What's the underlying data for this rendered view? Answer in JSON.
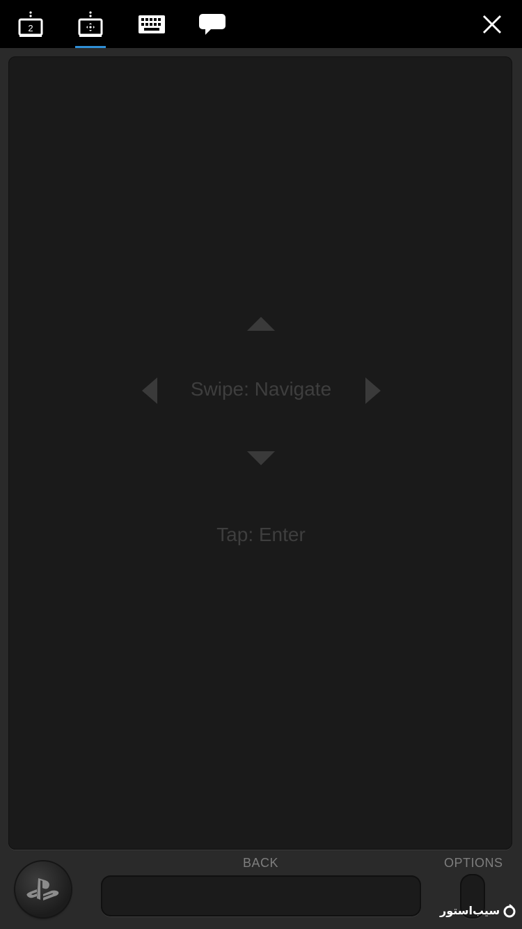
{
  "toolbar": {
    "tabs": [
      {
        "name": "second-screen-tab",
        "icon": "second-screen-icon",
        "badge": "2",
        "active": false
      },
      {
        "name": "remote-control-tab",
        "icon": "touchpad-icon",
        "active": true
      },
      {
        "name": "keyboard-tab",
        "icon": "keyboard-icon",
        "active": false
      },
      {
        "name": "comment-tab",
        "icon": "speech-bubble-icon",
        "active": false
      }
    ],
    "close_icon": "close-icon"
  },
  "touchpad": {
    "swipe_hint": "Swipe: Navigate",
    "tap_hint": "Tap: Enter",
    "arrow_icons": [
      "arrow-up-icon",
      "arrow-left-icon",
      "arrow-right-icon",
      "arrow-down-icon"
    ]
  },
  "controls": {
    "back_label": "BACK",
    "options_label": "OPTIONS",
    "ps_icon": "playstation-logo-icon"
  },
  "watermark": {
    "text": "سیب‌استور"
  },
  "colors": {
    "accent": "#2f8fd6",
    "background": "#2a2a2a",
    "touchpad": "#1a1a1a",
    "topbar": "#000000"
  }
}
